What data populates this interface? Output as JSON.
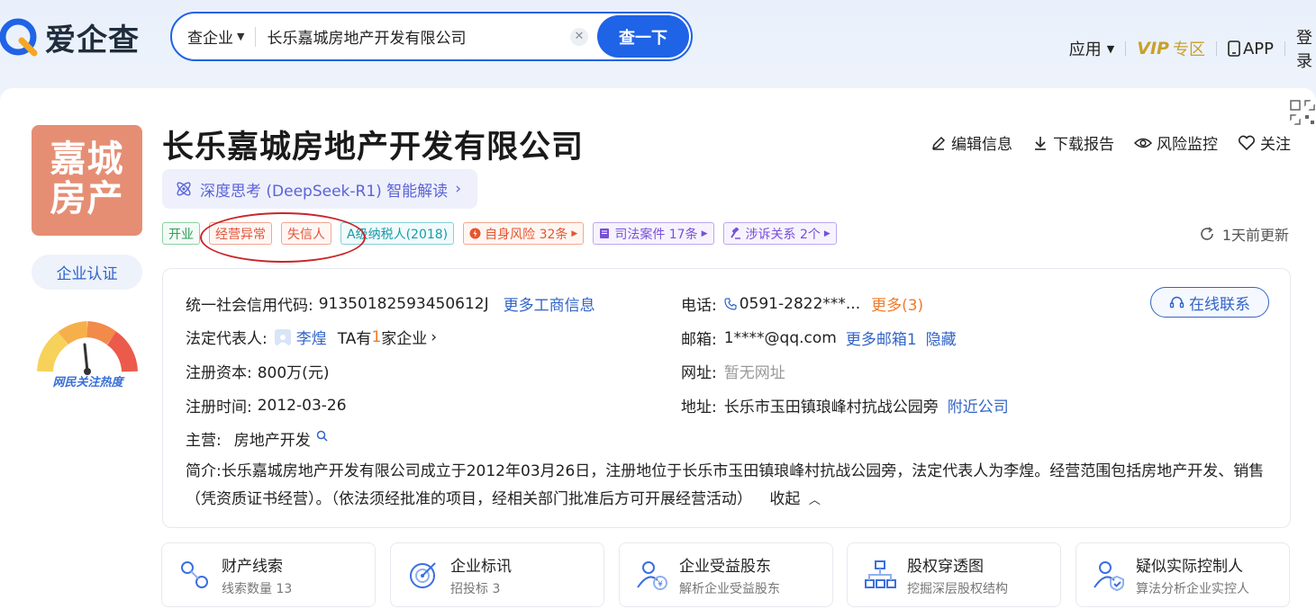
{
  "header": {
    "logo_text": "爱企查",
    "search_type": "查企业",
    "search_value": "长乐嘉城房地产开发有限公司",
    "search_button": "查一下",
    "nav": {
      "apps": "应用",
      "vip": "VIP",
      "vip_zone": "专区",
      "app": "APP",
      "login": "登录"
    }
  },
  "company": {
    "logo_line1": "嘉城",
    "logo_line2": "房产",
    "name": "长乐嘉城房地产开发有限公司",
    "ai_label": "深度思考 (DeepSeek-R1) 智能解读",
    "cert_label": "企业认证",
    "heat_label": "网民关注热度"
  },
  "actions": {
    "edit": "编辑信息",
    "download": "下载报告",
    "monitor": "风险监控",
    "follow": "关注"
  },
  "tags": {
    "open": "开业",
    "abnormal": "经营异常",
    "dishonest": "失信人",
    "taxpayer": "A级纳税人(2018)",
    "risk": "自身风险 32条",
    "judicial": "司法案件 17条",
    "litigation": "涉诉关系 2个"
  },
  "updated": "1天前更新",
  "info": {
    "credit_code_label": "统一社会信用代码:",
    "credit_code": "91350182593450612J",
    "more_biz": "更多工商信息",
    "legal_rep_label": "法定代表人:",
    "legal_rep": "李煌",
    "ta_prefix": "TA有",
    "ta_count": "1",
    "ta_suffix": "家企业",
    "capital_label": "注册资本:",
    "capital": "800万(元)",
    "reg_time_label": "注册时间:",
    "reg_time": "2012-03-26",
    "main_biz_label": "主营:",
    "main_biz": "房地产开发",
    "phone_label": "电话:",
    "phone": "0591-2822***...",
    "phone_more": "更多(3)",
    "email_label": "邮箱:",
    "email": "1****@qq.com",
    "email_more": "更多邮箱1",
    "email_hide": "隐藏",
    "website_label": "网址:",
    "website": "暂无网址",
    "address_label": "地址:",
    "address": "长乐市玉田镇琅峰村抗战公园旁",
    "nearby": "附近公司",
    "online_contact": "在线联系",
    "intro_label": "简介:",
    "intro_text": "长乐嘉城房地产开发有限公司成立于2012年03月26日，注册地位于长乐市玉田镇琅峰村抗战公园旁，法定代表人为李煌。经营范围包括房地产开发、销售（凭资质证书经营）。（依法须经批准的项目，经相关部门批准后方可开展经营活动）",
    "collapse": "收起"
  },
  "quick_links": [
    {
      "title": "财产线索",
      "sub": "线索数量 13"
    },
    {
      "title": "企业标讯",
      "sub": "招投标 3"
    },
    {
      "title": "企业受益股东",
      "sub": "解析企业受益股东"
    },
    {
      "title": "股权穿透图",
      "sub": "挖掘深层股权结构"
    },
    {
      "title": "疑似实际控制人",
      "sub": "算法分析企业实控人"
    }
  ],
  "colors": {
    "brand_blue": "#1f63e6",
    "logo_bg": "#e58e74",
    "alert_red": "#c9262a",
    "vip_gold": "#c9a02b"
  }
}
